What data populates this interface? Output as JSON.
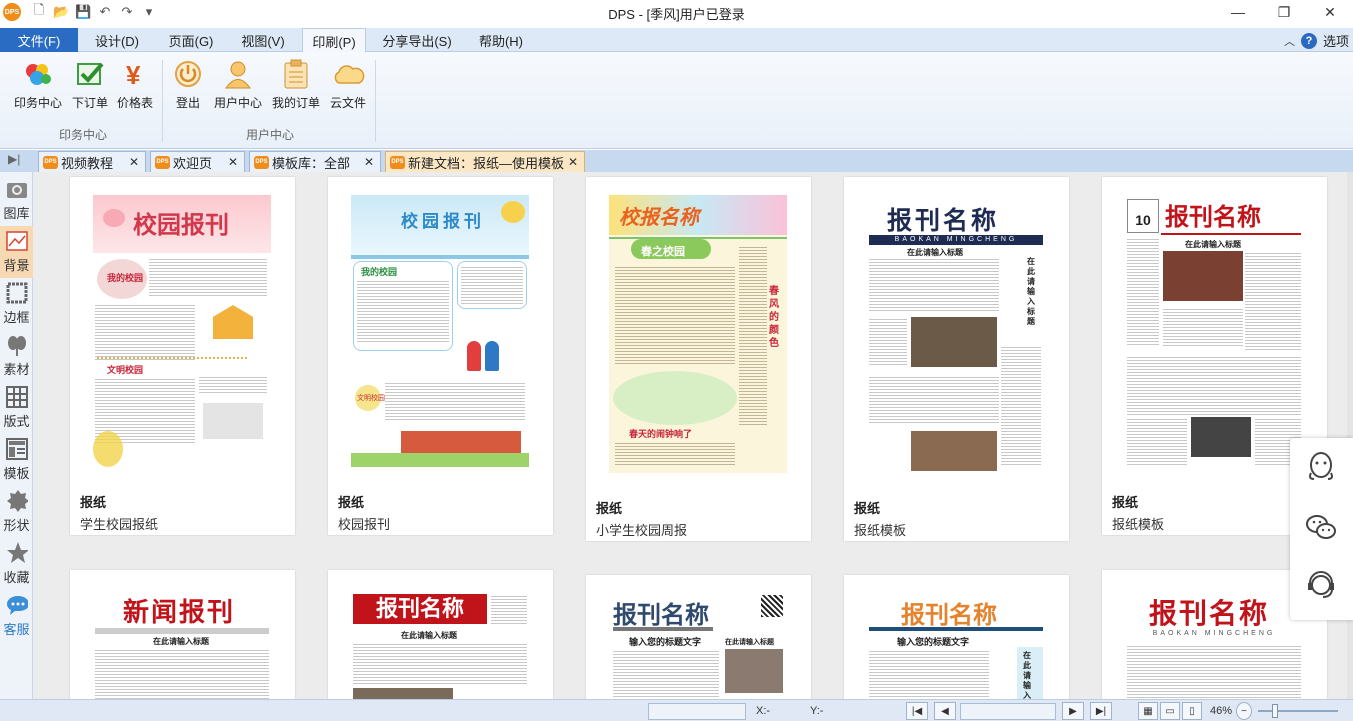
{
  "window": {
    "title": "DPS - [季风]用户已登录",
    "app_logo": "DPS",
    "controls": [
      "minimize-icon",
      "restore-icon",
      "close-icon"
    ]
  },
  "quick_access": [
    "new-icon",
    "open-icon",
    "save-icon",
    "undo-icon",
    "redo-icon",
    "dropdown-icon"
  ],
  "menu": {
    "tabs": [
      "文件(F)",
      "设计(D)",
      "页面(G)",
      "视图(V)",
      "印刷(P)",
      "分享导出(S)",
      "帮助(H)"
    ],
    "active": "印刷(P)",
    "right": {
      "help": "?",
      "options": "选项"
    }
  },
  "ribbon": {
    "groups": [
      {
        "label": "印务中心",
        "buttons": [
          "印务中心",
          "下订单",
          "价格表"
        ]
      },
      {
        "label": "用户中心",
        "buttons": [
          "登出",
          "用户中心",
          "我的订单",
          "云文件"
        ]
      }
    ]
  },
  "doc_tabs": [
    {
      "label": "视频教程",
      "active": false
    },
    {
      "label": "欢迎页",
      "active": false
    },
    {
      "label": "模板库：全部",
      "active": false
    },
    {
      "label": "新建文档：报纸—使用模板",
      "active": true
    }
  ],
  "sidebar": [
    {
      "label": "图库",
      "icon": "gallery-icon"
    },
    {
      "label": "背景",
      "icon": "background-icon",
      "active": true
    },
    {
      "label": "边框",
      "icon": "border-icon"
    },
    {
      "label": "素材",
      "icon": "material-icon"
    },
    {
      "label": "版式",
      "icon": "layout-icon"
    },
    {
      "label": "模板",
      "icon": "template-icon"
    },
    {
      "label": "形状",
      "icon": "shape-icon"
    },
    {
      "label": "收藏",
      "icon": "star-icon"
    },
    {
      "label": "客服",
      "icon": "chat-icon"
    }
  ],
  "templates": [
    {
      "category": "报纸",
      "name": "学生校园报纸",
      "thumb_title": "校园报刊"
    },
    {
      "category": "报纸",
      "name": "校园报刊",
      "thumb_title": "校园报刊"
    },
    {
      "category": "报纸",
      "name": "小学生校园周报",
      "thumb_title": "校报名称"
    },
    {
      "category": "报纸",
      "name": "报纸模板",
      "thumb_title": "报刊名称"
    },
    {
      "category": "报纸",
      "name": "报纸模板",
      "thumb_title": "报刊名称"
    },
    {
      "thumb_title": "新闻报刊"
    },
    {
      "thumb_title": "报刊名称"
    },
    {
      "thumb_title": "报刊名称"
    },
    {
      "thumb_title": "报刊名称"
    },
    {
      "thumb_title": "报刊名称"
    }
  ],
  "thumb_text": {
    "t1_sub1": "我的校园",
    "t1_sub2": "文明校园",
    "t2_sub1": "我的校园",
    "t2_sub2": "文明校园",
    "t3_banner": "春之校园",
    "t3_side": "春风的颜色",
    "t3_sub": "春天的闹钟响了",
    "t4_pinyin": "BAOKAN MINGCHENG",
    "t4_head": "在此请输入标题",
    "t4_side": "在此请输入标题",
    "t5_num": "10",
    "t5_head": "在此请输入标题",
    "t8_head": "输入您的标题文字",
    "t8_head2": "在此请输入标题",
    "t9_head": "输入您的标题文字",
    "t9_side": "在此请输入标题",
    "t10_pinyin": "BAOKAN MINGCHENG",
    "t6_head": "在此请输入标题",
    "t7_head": "在此请输入标题"
  },
  "float_service": [
    "qq-icon",
    "wechat-icon",
    "customer-service-icon"
  ],
  "statusbar": {
    "x_label": "X:-",
    "y_label": "Y:-",
    "zoom": "46%"
  }
}
